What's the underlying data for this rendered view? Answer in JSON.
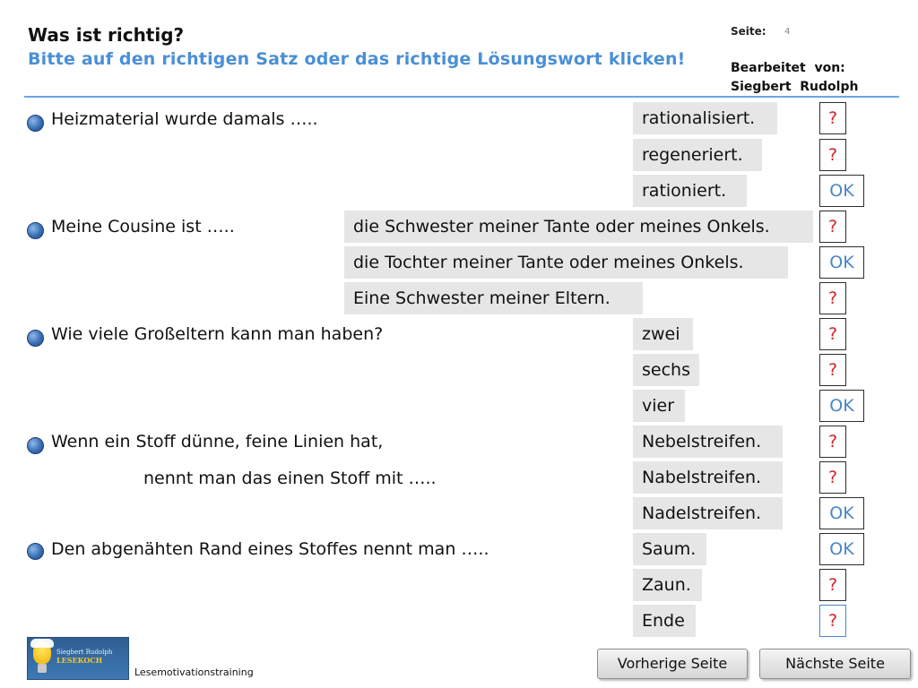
{
  "header": {
    "title": "Was ist richtig?",
    "subtitle": "Bitte auf den richtigen Satz oder das richtige Lösungswort klicken!",
    "page_label": "Seite:",
    "page_number": "4",
    "author_label_line1": "Bearbeitet  von:",
    "author_label_line2": "Siegbert  Rudolph"
  },
  "questions": [
    {
      "text": "Heizmaterial wurde damals …..",
      "answers": [
        {
          "label": "rationalisiert.",
          "feedback": "?"
        },
        {
          "label": "regeneriert.",
          "feedback": "?"
        },
        {
          "label": "rationiert.",
          "feedback": "OK"
        }
      ]
    },
    {
      "text": "Meine Cousine ist …..",
      "answers": [
        {
          "label": "die Schwester meiner Tante oder meines Onkels.",
          "feedback": "?"
        },
        {
          "label": "die Tochter meiner Tante oder meines Onkels.",
          "feedback": "OK"
        },
        {
          "label": "Eine Schwester meiner Eltern.",
          "feedback": "?"
        }
      ]
    },
    {
      "text": "Wie viele Großeltern kann man haben?",
      "answers": [
        {
          "label": "zwei",
          "feedback": "?"
        },
        {
          "label": "sechs",
          "feedback": "?"
        },
        {
          "label": "vier",
          "feedback": "OK"
        }
      ]
    },
    {
      "text": "Wenn ein Stoff dünne, feine Linien hat,",
      "text_line2": "nennt man das einen Stoff mit …..",
      "answers": [
        {
          "label": "Nebelstreifen.",
          "feedback": "?"
        },
        {
          "label": "Nabelstreifen.",
          "feedback": "?"
        },
        {
          "label": "Nadelstreifen.",
          "feedback": "OK"
        }
      ]
    },
    {
      "text": "Den abgenähten Rand eines Stoffes nennt man …..",
      "answers": [
        {
          "label": "Saum.",
          "feedback": "OK"
        },
        {
          "label": "Zaun.",
          "feedback": "?"
        },
        {
          "label": "Ende",
          "feedback": "?"
        }
      ]
    }
  ],
  "footer": {
    "logo_line1": "Siegbert Rudolph",
    "logo_line2": "LESEKOCH",
    "label": "Lesemotivationstraining",
    "prev_button": "Vorherige Seite",
    "next_button": "Nächste Seite"
  },
  "colors": {
    "accent_blue": "#4a8fd6",
    "wrong_red": "#d81f26",
    "ok_blue": "#4a86c8",
    "answer_bg": "#e6e6e6"
  }
}
